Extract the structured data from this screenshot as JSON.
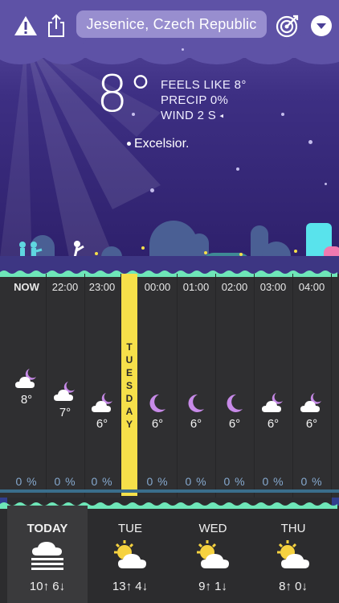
{
  "header": {
    "location": "Jesenice, Czech Republic"
  },
  "current": {
    "temp": "8°",
    "feels_like": "FEELS LIKE 8°",
    "precip": "PRECIP 0%",
    "wind": "WIND 2 S",
    "tagline": "Excelsior."
  },
  "hourly": [
    {
      "time": "NOW",
      "temp": "8°",
      "precip": "0 %",
      "icon": "cloud-moon-icon"
    },
    {
      "time": "22:00",
      "temp": "7°",
      "precip": "0 %",
      "icon": "cloud-moon-icon"
    },
    {
      "time": "23:00",
      "temp": "6°",
      "precip": "0 %",
      "icon": "cloud-moon-icon"
    },
    {
      "time": "00:00",
      "temp": "6°",
      "precip": "0 %",
      "icon": "moon-icon"
    },
    {
      "time": "01:00",
      "temp": "6°",
      "precip": "0 %",
      "icon": "moon-icon"
    },
    {
      "time": "02:00",
      "temp": "6°",
      "precip": "0 %",
      "icon": "moon-icon"
    },
    {
      "time": "03:00",
      "temp": "6°",
      "precip": "0 %",
      "icon": "cloud-moon-icon"
    },
    {
      "time": "04:00",
      "temp": "6°",
      "precip": "0 %",
      "icon": "cloud-moon-icon"
    }
  ],
  "day_divider": {
    "letters": [
      "T",
      "U",
      "E",
      "S",
      "D",
      "A",
      "Y"
    ]
  },
  "daily": [
    {
      "name": "TODAY",
      "range": "10↑ 6↓",
      "icon": "fog-cloud-icon"
    },
    {
      "name": "TUE",
      "range": "13↑ 4↓",
      "icon": "partly-sunny-icon"
    },
    {
      "name": "WED",
      "range": "9↑ 1↓",
      "icon": "partly-sunny-icon"
    },
    {
      "name": "THU",
      "range": "8↑ 0↓",
      "icon": "partly-sunny-icon"
    }
  ],
  "colors": {
    "sky_top": "#5d4fa3",
    "sky_bottom": "#2d1f6a",
    "ground_green": "#6ee6b8",
    "divider_yellow": "#f6e04a",
    "moon_purple": "#c78ae8",
    "precip_blue": "#86a9cf"
  }
}
